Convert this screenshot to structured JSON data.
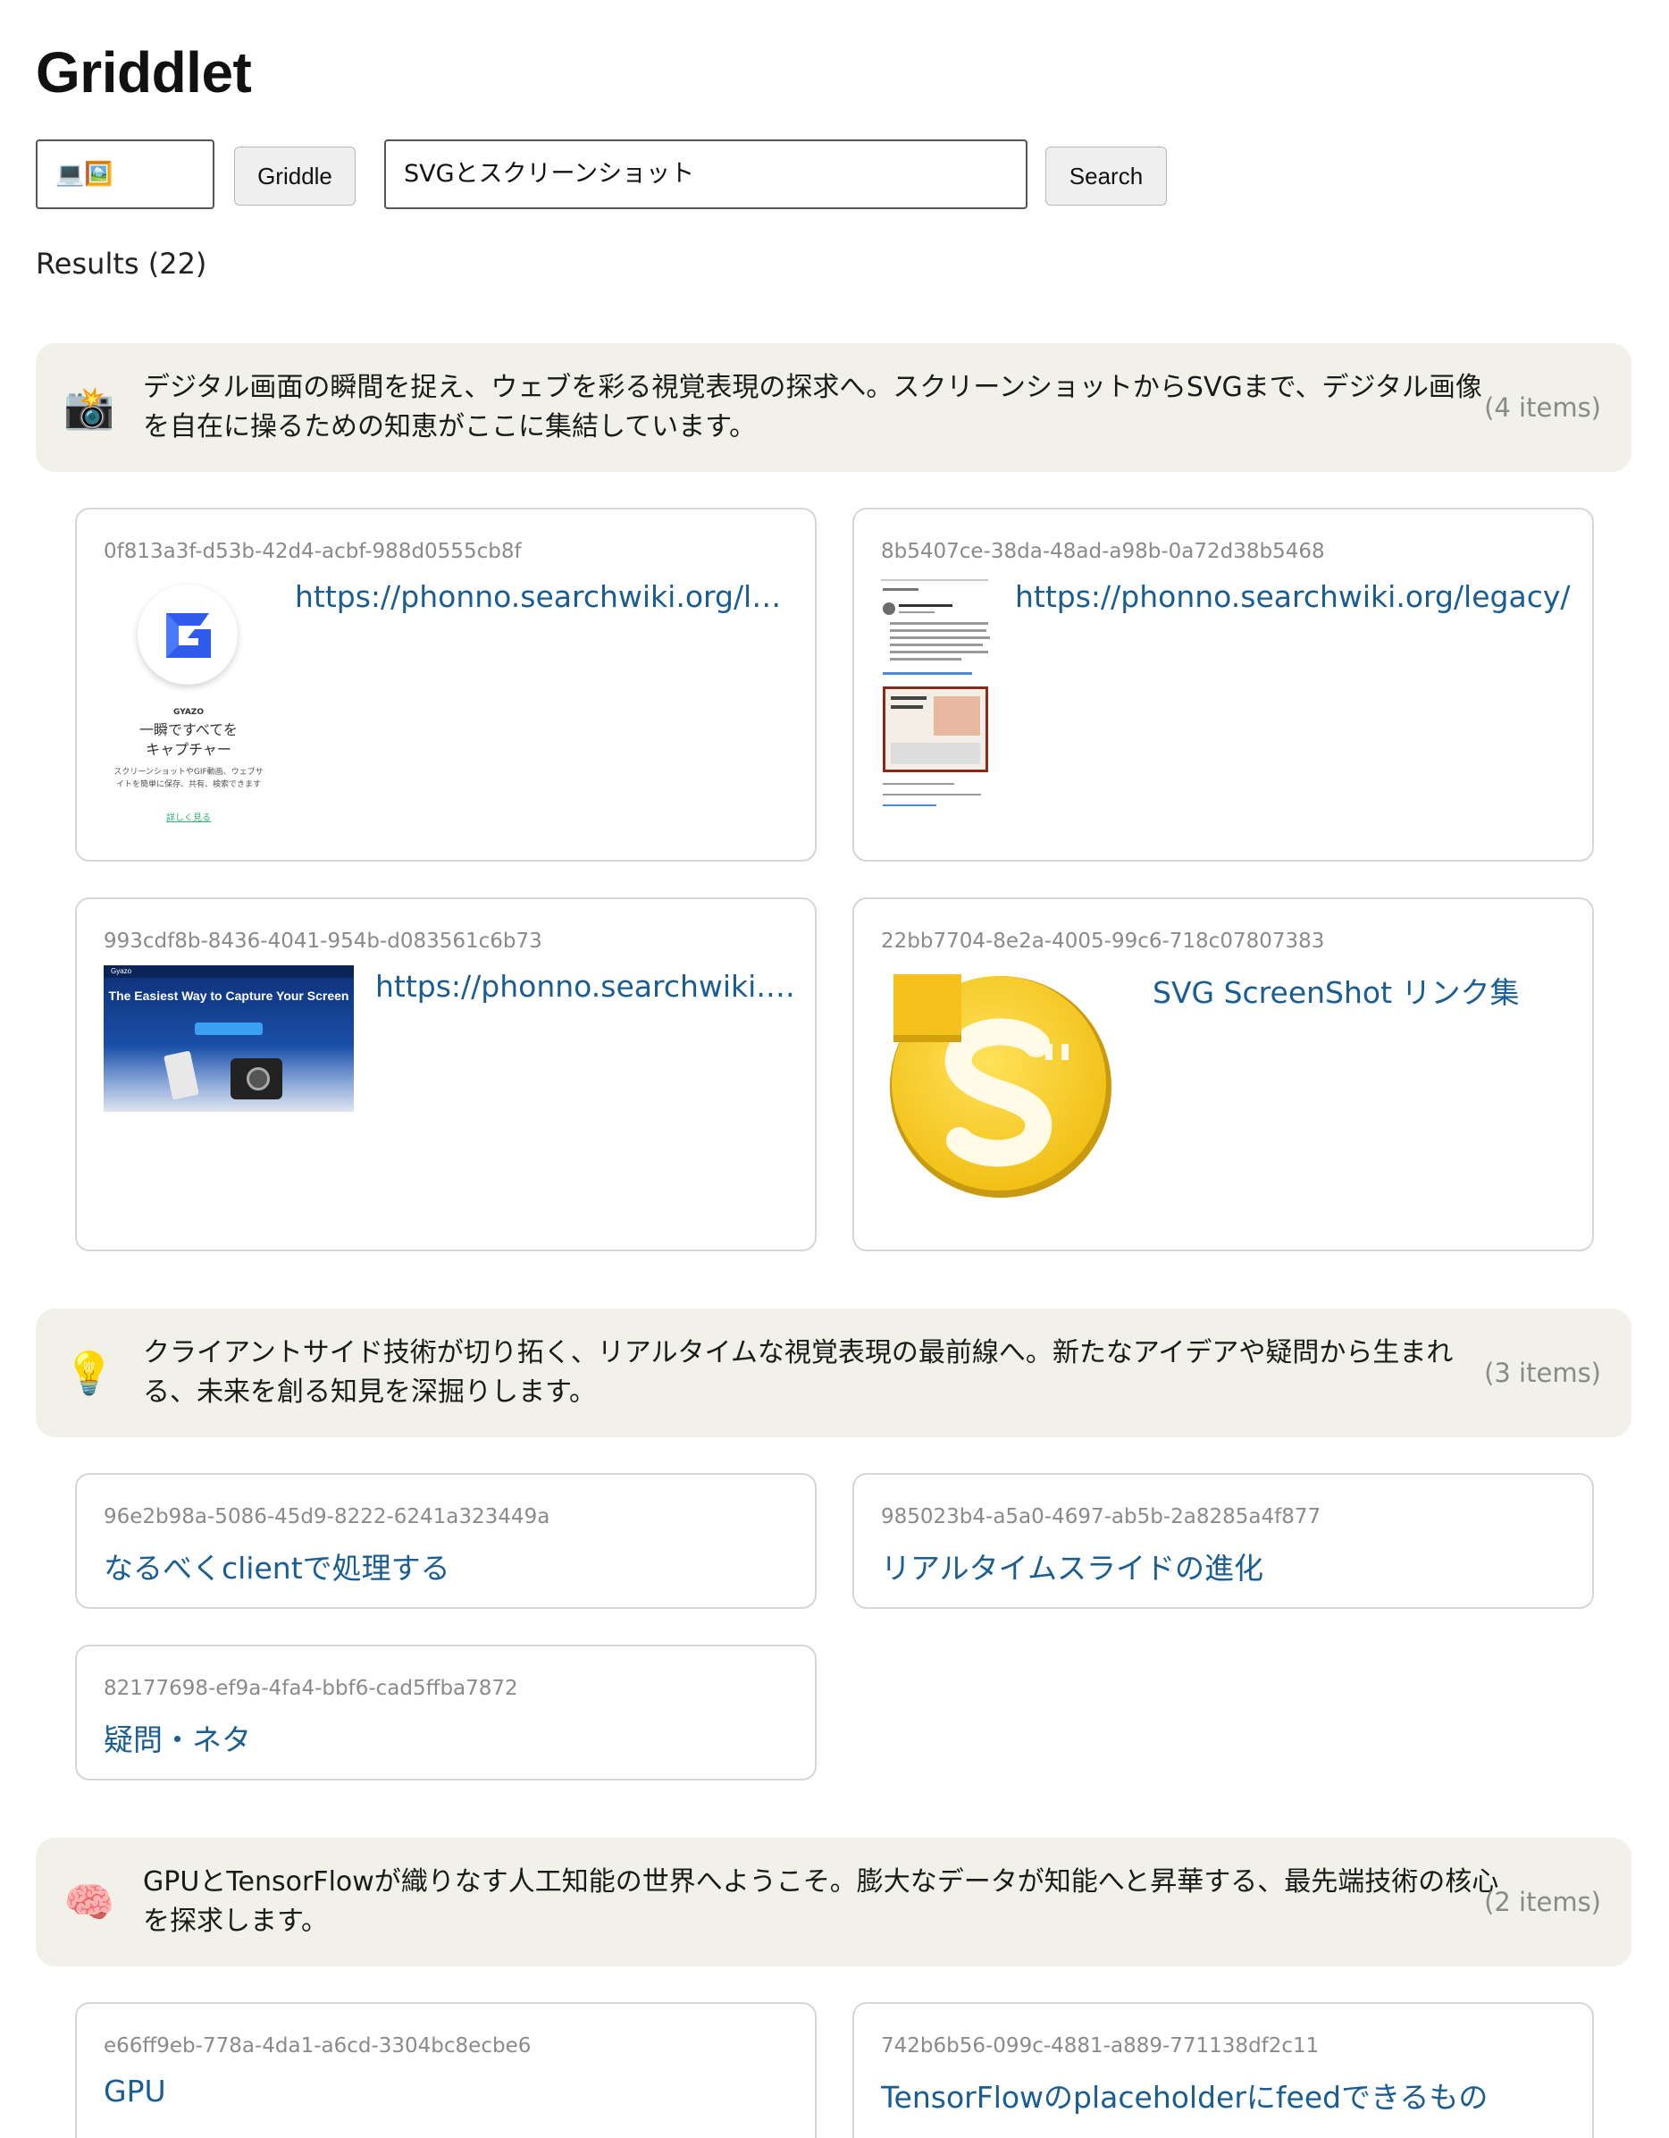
{
  "app": {
    "title": "Griddlet"
  },
  "toolbar": {
    "emoji_value": "💻🖼️",
    "griddle_label": "Griddle",
    "search_value": "SVGとスクリーンショット",
    "search_label": "Search"
  },
  "results": {
    "label": "Results (22)"
  },
  "groups": [
    {
      "emoji": "📸",
      "text": "デジタル画面の瞬間を捉え、ウェブを彩る視覚表現の探求へ。スクリーンショットからSVGまで、デジタル画像を自在に操るための知恵がここに集結しています。",
      "count": "(4 items)",
      "cards": [
        {
          "id": "0f813a3f-d53b-42d4-acbf-988d0555cb8f",
          "link": "https://phonno.searchwiki.org/legacy/",
          "thumb": {
            "brand": "GYAZO",
            "headline_1": "一瞬ですべてを",
            "headline_2": "キャプチャー",
            "desc_1": "スクリーンショットやGIF動画、ウェブサ",
            "desc_2": "イトを簡単に保存、共有、検索できます",
            "more": "詳しく見る"
          }
        },
        {
          "id": "8b5407ce-38da-48ad-a98b-0a72d38b5468",
          "link": "https://phonno.searchwiki.org/legacy/"
        },
        {
          "id": "993cdf8b-8436-4041-954b-d083561c6b73",
          "link": "https://phonno.searchwiki.org/legacy/",
          "thumb": {
            "brand": "Gyazo",
            "headline": "The Easiest Way to Capture Your Screen"
          }
        },
        {
          "id": "22bb7704-8e2a-4005-99c6-718c07807383",
          "link": "SVG ScreenShot リンク集"
        }
      ]
    },
    {
      "emoji": "💡",
      "text": "クライアントサイド技術が切り拓く、リアルタイムな視覚表現の最前線へ。新たなアイデアや疑問から生まれる、未来を創る知見を深掘りします。",
      "count": "(3 items)",
      "cards": [
        {
          "id": "96e2b98a-5086-45d9-8222-6241a323449a",
          "link": "なるべくclientで処理する"
        },
        {
          "id": "985023b4-a5a0-4697-ab5b-2a8285a4f877",
          "link": "リアルタイムスライドの進化"
        },
        {
          "id": "82177698-ef9a-4fa4-bbf6-cad5ffba7872",
          "link": "疑問・ネタ"
        }
      ]
    },
    {
      "emoji": "🧠",
      "text": "GPUとTensorFlowが織りなす人工知能の世界へようこそ。膨大なデータが知能へと昇華する、最先端技術の核心を探求します。",
      "count": "(2 items)",
      "cards": [
        {
          "id": "e66ff9eb-778a-4da1-a6cd-3304bc8ecbe6",
          "link": "GPU"
        },
        {
          "id": "742b6b56-099c-4881-a889-771138df2c11",
          "link": "TensorFlowのplaceholderにfeedできるもの"
        }
      ]
    }
  ]
}
